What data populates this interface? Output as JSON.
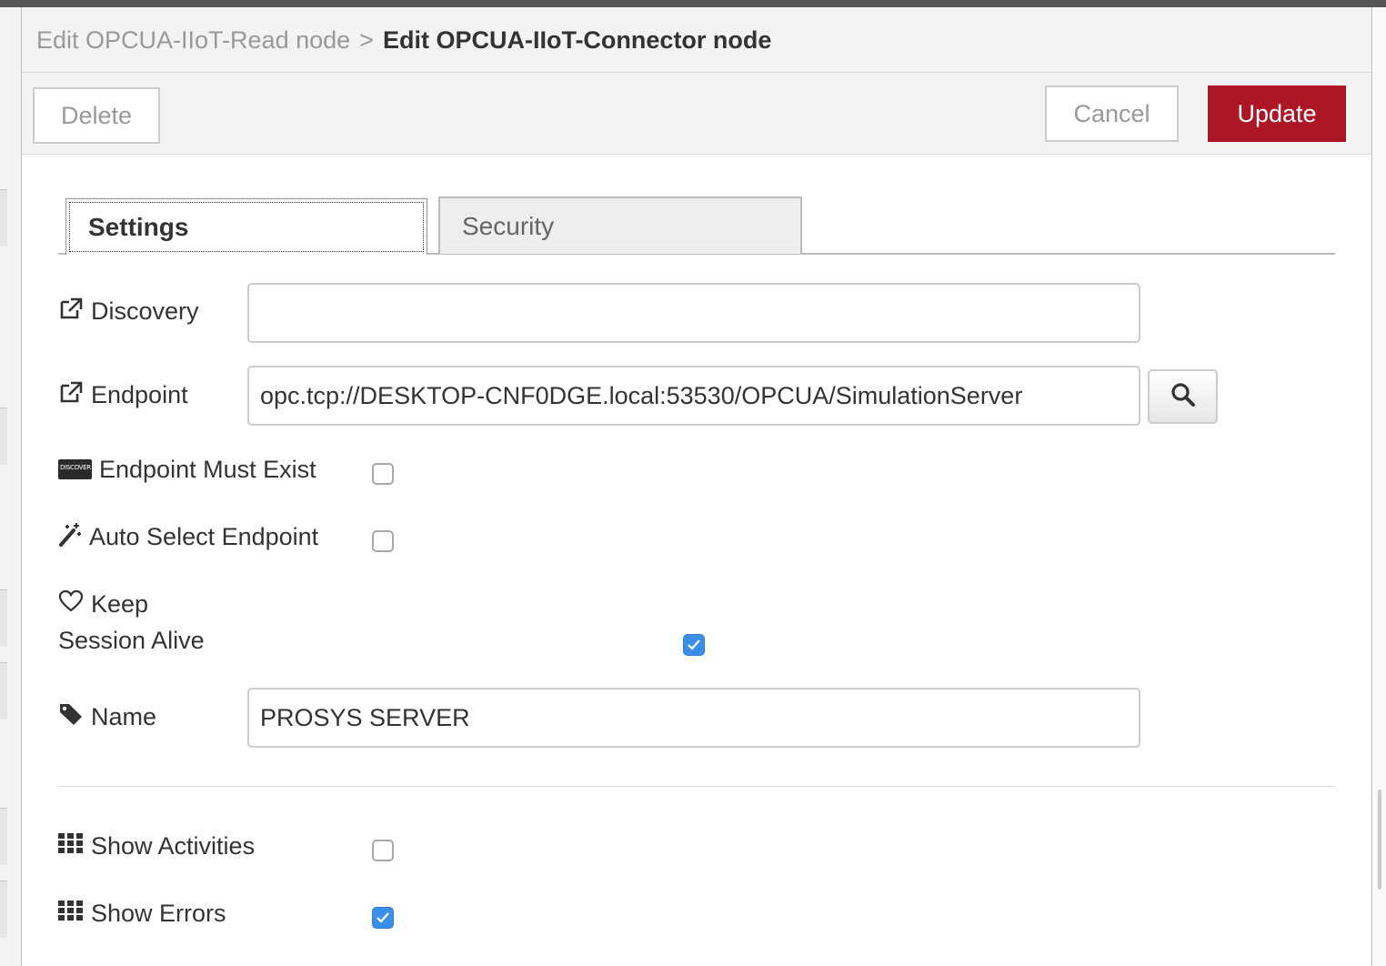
{
  "breadcrumb": {
    "previous": "Edit OPCUA-IIoT-Read node",
    "separator": ">",
    "current": "Edit OPCUA-IIoT-Connector node"
  },
  "toolbar": {
    "delete_label": "Delete",
    "cancel_label": "Cancel",
    "update_label": "Update"
  },
  "tabs": [
    {
      "label": "Settings",
      "active": true
    },
    {
      "label": "Security",
      "active": false
    }
  ],
  "form": {
    "discovery": {
      "label": "Discovery",
      "icon": "external-link-icon",
      "value": ""
    },
    "endpoint": {
      "label": "Endpoint",
      "icon": "external-link-icon",
      "value": "opc.tcp://DESKTOP-CNF0DGE.local:53530/OPCUA/SimulationServer",
      "search_icon": "search-icon"
    },
    "endpoint_must_exist": {
      "label": "Endpoint Must Exist",
      "icon": "discover-card-icon",
      "icon_text": "DISCOVER",
      "checked": false
    },
    "auto_select_endpoint": {
      "label": "Auto Select Endpoint",
      "icon": "magic-wand-icon",
      "checked": false
    },
    "keep_session_alive": {
      "label_line1": "Keep",
      "label_line2": "Session Alive",
      "icon": "heart-outline-icon",
      "checked": true
    },
    "name": {
      "label": "Name",
      "icon": "tag-icon",
      "value": "PROSYS SERVER"
    },
    "show_activities": {
      "label": "Show Activities",
      "icon": "grid-icon",
      "checked": false
    },
    "show_errors": {
      "label": "Show Errors",
      "icon": "grid-icon",
      "checked": true
    }
  },
  "colors": {
    "update_button": "#ad1625",
    "checkbox_checked": "#3b8eea",
    "header_background": "#f3f3f3"
  }
}
